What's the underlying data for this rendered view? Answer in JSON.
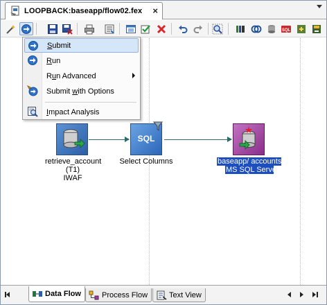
{
  "tab": {
    "title": "LOOPBACK:baseapp/flow02.fex",
    "close": "×"
  },
  "toolbar_icons": [
    "wand-icon",
    "run-icon",
    "save-icon",
    "save-all-icon",
    "print-icon",
    "properties-icon",
    "sql-report-icon",
    "check-icon",
    "delete-icon",
    "undo-icon",
    "redo-icon",
    "zoom-icon",
    "lights-icon",
    "join-icon",
    "db-icon",
    "sql-icon",
    "filter-icon",
    "target-icon",
    "save-target-icon"
  ],
  "menu": {
    "items": [
      {
        "label": "Submit",
        "icon": "submit-icon",
        "highlighted": true
      },
      {
        "label": "Run",
        "icon": "run-icon"
      },
      {
        "label": "Run Advanced",
        "icon": "",
        "submenu": true
      },
      {
        "label": "Submit with Options",
        "icon": "submit-options-icon"
      },
      {
        "label": "Impact Analysis",
        "icon": "impact-analysis-icon"
      }
    ]
  },
  "flow": {
    "source": {
      "line1": "retrieve_account",
      "line2": "(T1)",
      "line3": "IWAF"
    },
    "transform": {
      "icon_text": "SQL",
      "label": "Select Columns"
    },
    "target": {
      "line1": "baseapp/ accounts",
      "line2": "MS SQL Server"
    }
  },
  "bottom_tabs": [
    {
      "label": "Data Flow",
      "active": true
    },
    {
      "label": "Process Flow",
      "active": false
    },
    {
      "label": "Text View",
      "active": false
    }
  ],
  "colors": {
    "selection": "#1c4fbd",
    "menu_highlight": "#d6e6f9",
    "node_blue": "#3c73b6",
    "node_purple": "#9b3f9b",
    "connector": "#2d6b6b"
  }
}
